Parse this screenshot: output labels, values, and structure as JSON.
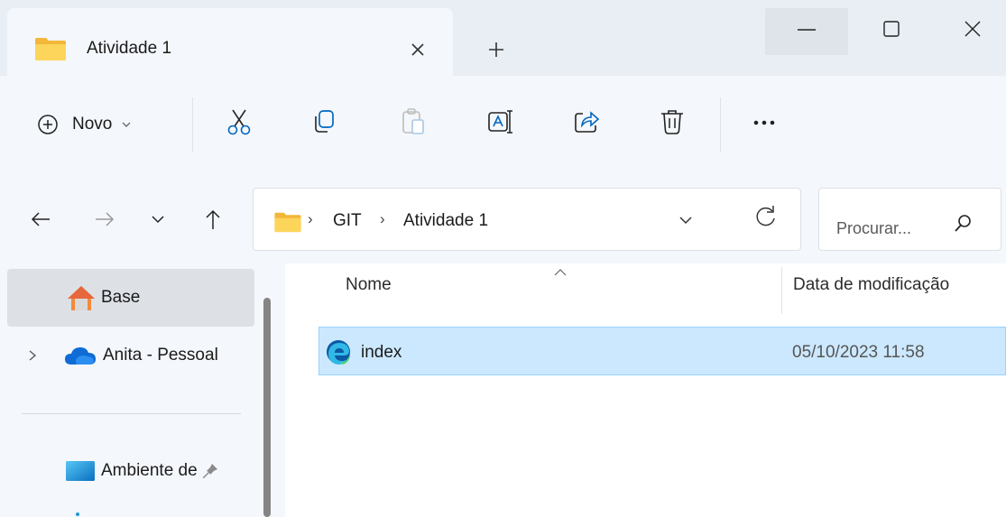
{
  "tab": {
    "title": "Atividade 1"
  },
  "toolbar": {
    "new_label": "Novo"
  },
  "address": {
    "crumbs": [
      "GIT",
      "Atividade 1"
    ]
  },
  "search": {
    "placeholder": "Procurar..."
  },
  "nav": {
    "items": [
      "Base",
      "Anita - Pessoal",
      "Ambiente de"
    ]
  },
  "list": {
    "columns": [
      "Nome",
      "Data de modificação"
    ],
    "rows": [
      {
        "name": "index",
        "modified": "05/10/2023 11:58"
      }
    ]
  },
  "colors": {
    "selection": "#cce8ff",
    "folder": "#f8c945",
    "accent": "#0067c0"
  }
}
